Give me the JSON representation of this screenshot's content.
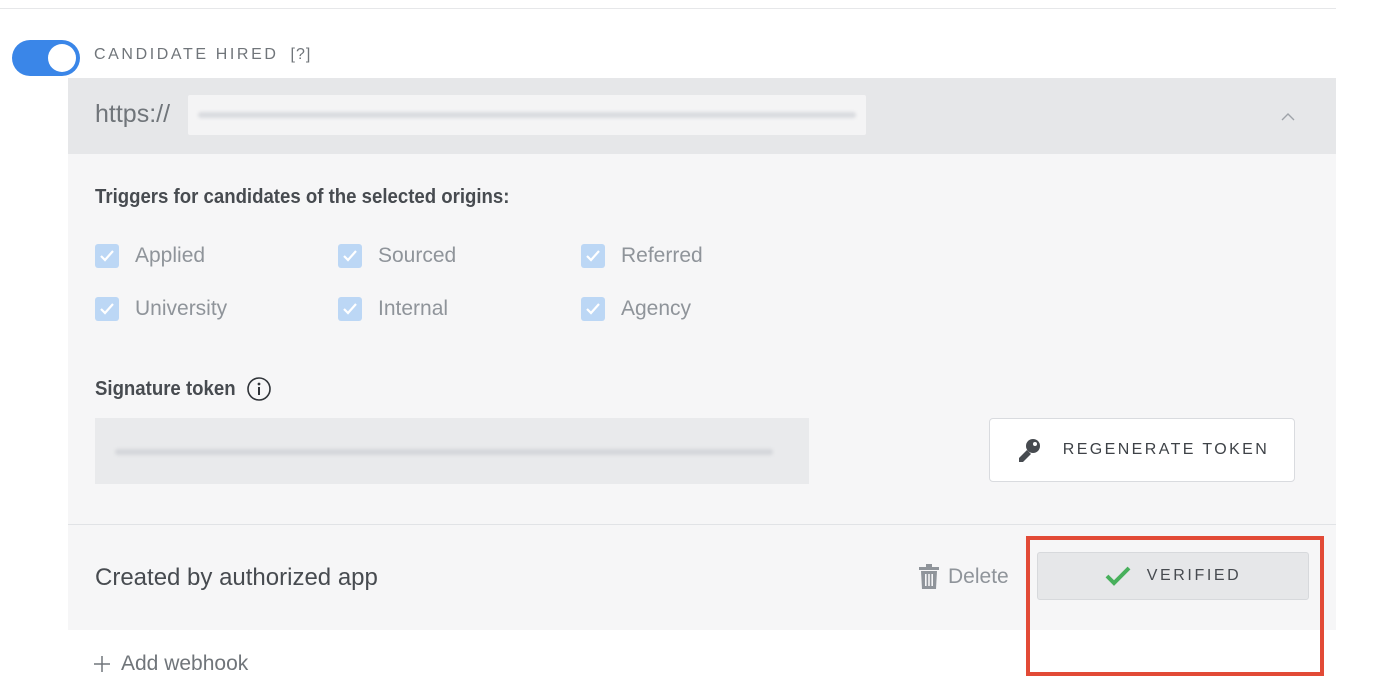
{
  "webhook": {
    "event_title": "CANDIDATE HIRED",
    "help_link": "[?]",
    "enabled": true,
    "url_prefix": "https://",
    "url_value": "",
    "triggers_heading": "Triggers for candidates of the selected origins:",
    "origins": [
      {
        "label": "Applied",
        "checked": true
      },
      {
        "label": "Sourced",
        "checked": true
      },
      {
        "label": "Referred",
        "checked": true
      },
      {
        "label": "University",
        "checked": true
      },
      {
        "label": "Internal",
        "checked": true
      },
      {
        "label": "Agency",
        "checked": true
      }
    ],
    "signature_heading": "Signature token",
    "signature_token": "",
    "regenerate_label": "REGENERATE TOKEN",
    "created_by": "Created by authorized app",
    "delete_label": "Delete",
    "verified_label": "VERIFIED"
  },
  "footer": {
    "add_webhook_label": "Add webhook"
  },
  "colors": {
    "toggle_on": "#3a86e8",
    "checkbox_checked": "#bcd7f5",
    "verified_check": "#48b05c",
    "highlight": "#e24a36"
  },
  "icons": {
    "chevron": "chevron-up-icon",
    "info": "info-icon",
    "key": "key-icon",
    "trash": "trash-icon",
    "check": "check-icon",
    "plus": "plus-icon"
  }
}
